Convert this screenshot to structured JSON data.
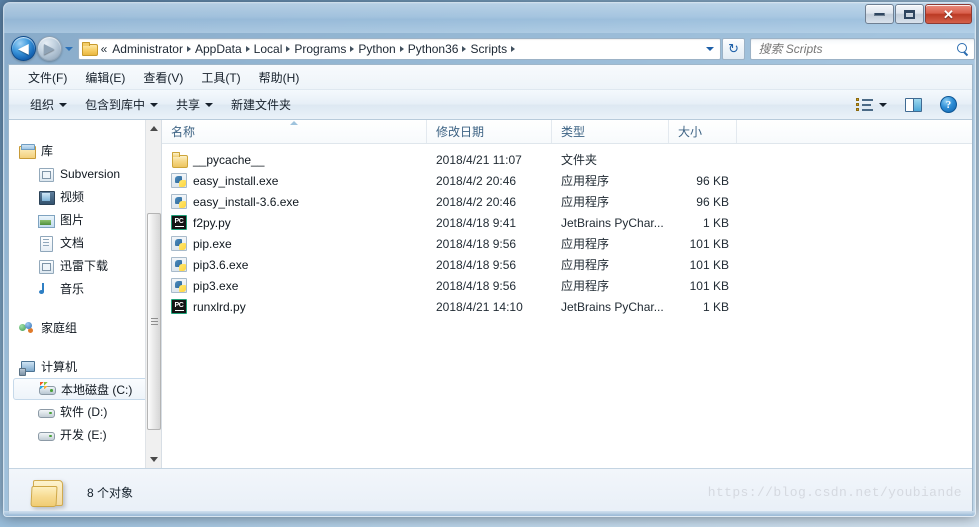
{
  "window": {
    "controls": {
      "minimize": "minimize",
      "maximize": "maximize",
      "close": "✕"
    }
  },
  "address": {
    "overflow": "«",
    "crumbs": [
      {
        "label": "Administrator"
      },
      {
        "label": "AppData"
      },
      {
        "label": "Local"
      },
      {
        "label": "Programs"
      },
      {
        "label": "Python"
      },
      {
        "label": "Python36"
      },
      {
        "label": "Scripts"
      }
    ],
    "refresh_glyph": "↻"
  },
  "search": {
    "value": "",
    "placeholder": "搜索 Scripts"
  },
  "menubar": {
    "items": [
      {
        "label": "文件(F)"
      },
      {
        "label": "编辑(E)"
      },
      {
        "label": "查看(V)"
      },
      {
        "label": "工具(T)"
      },
      {
        "label": "帮助(H)"
      }
    ]
  },
  "commandbar": {
    "organize": "组织",
    "include_in_library": "包含到库中",
    "share": "共享",
    "new_folder": "新建文件夹",
    "help_glyph": "?"
  },
  "sidebar": {
    "groups": [
      {
        "root": {
          "label": "库",
          "icon": "library-icon"
        },
        "items": [
          {
            "label": "Subversion",
            "icon": "subversion-icon"
          },
          {
            "label": "视频",
            "icon": "video-icon"
          },
          {
            "label": "图片",
            "icon": "pictures-icon"
          },
          {
            "label": "文档",
            "icon": "documents-icon"
          },
          {
            "label": "迅雷下载",
            "icon": "thunder-download-icon"
          },
          {
            "label": "音乐",
            "icon": "music-icon"
          }
        ]
      },
      {
        "root": {
          "label": "家庭组",
          "icon": "homegroup-icon"
        },
        "items": []
      },
      {
        "root": {
          "label": "计算机",
          "icon": "computer-icon"
        },
        "items": [
          {
            "label": "本地磁盘 (C:)",
            "icon": "system-drive-icon",
            "selected": true
          },
          {
            "label": "软件 (D:)",
            "icon": "drive-icon",
            "selected": false
          },
          {
            "label": "开发 (E:)",
            "icon": "drive-icon",
            "selected": false
          }
        ]
      }
    ]
  },
  "filelist": {
    "columns": [
      {
        "key": "name",
        "label": "名称",
        "sorted": true
      },
      {
        "key": "date",
        "label": "修改日期",
        "sorted": false
      },
      {
        "key": "type",
        "label": "类型",
        "sorted": false
      },
      {
        "key": "size",
        "label": "大小",
        "sorted": false
      }
    ],
    "rows": [
      {
        "name": "__pycache__",
        "date": "2018/4/21 11:07",
        "type": "文件夹",
        "size": "",
        "icon": "folder-icon"
      },
      {
        "name": "easy_install.exe",
        "date": "2018/4/2 20:46",
        "type": "应用程序",
        "size": "96 KB",
        "icon": "python-exe-icon"
      },
      {
        "name": "easy_install-3.6.exe",
        "date": "2018/4/2 20:46",
        "type": "应用程序",
        "size": "96 KB",
        "icon": "python-exe-icon"
      },
      {
        "name": "f2py.py",
        "date": "2018/4/18 9:41",
        "type": "JetBrains PyChar...",
        "size": "1 KB",
        "icon": "pycharm-file-icon"
      },
      {
        "name": "pip.exe",
        "date": "2018/4/18 9:56",
        "type": "应用程序",
        "size": "101 KB",
        "icon": "python-exe-icon"
      },
      {
        "name": "pip3.6.exe",
        "date": "2018/4/18 9:56",
        "type": "应用程序",
        "size": "101 KB",
        "icon": "python-exe-icon"
      },
      {
        "name": "pip3.exe",
        "date": "2018/4/18 9:56",
        "type": "应用程序",
        "size": "101 KB",
        "icon": "python-exe-icon"
      },
      {
        "name": "runxlrd.py",
        "date": "2018/4/21 14:10",
        "type": "JetBrains PyChar...",
        "size": "1 KB",
        "icon": "pycharm-file-icon"
      }
    ]
  },
  "statusbar": {
    "item_count": "8 个对象"
  },
  "watermark": {
    "text": "https://blog.csdn.net/youbiande"
  },
  "colors": {
    "accent": "#1d5fa8",
    "close_button": "#bb3a24",
    "header_text": "#3d6384",
    "selection": "#eef4fa"
  }
}
